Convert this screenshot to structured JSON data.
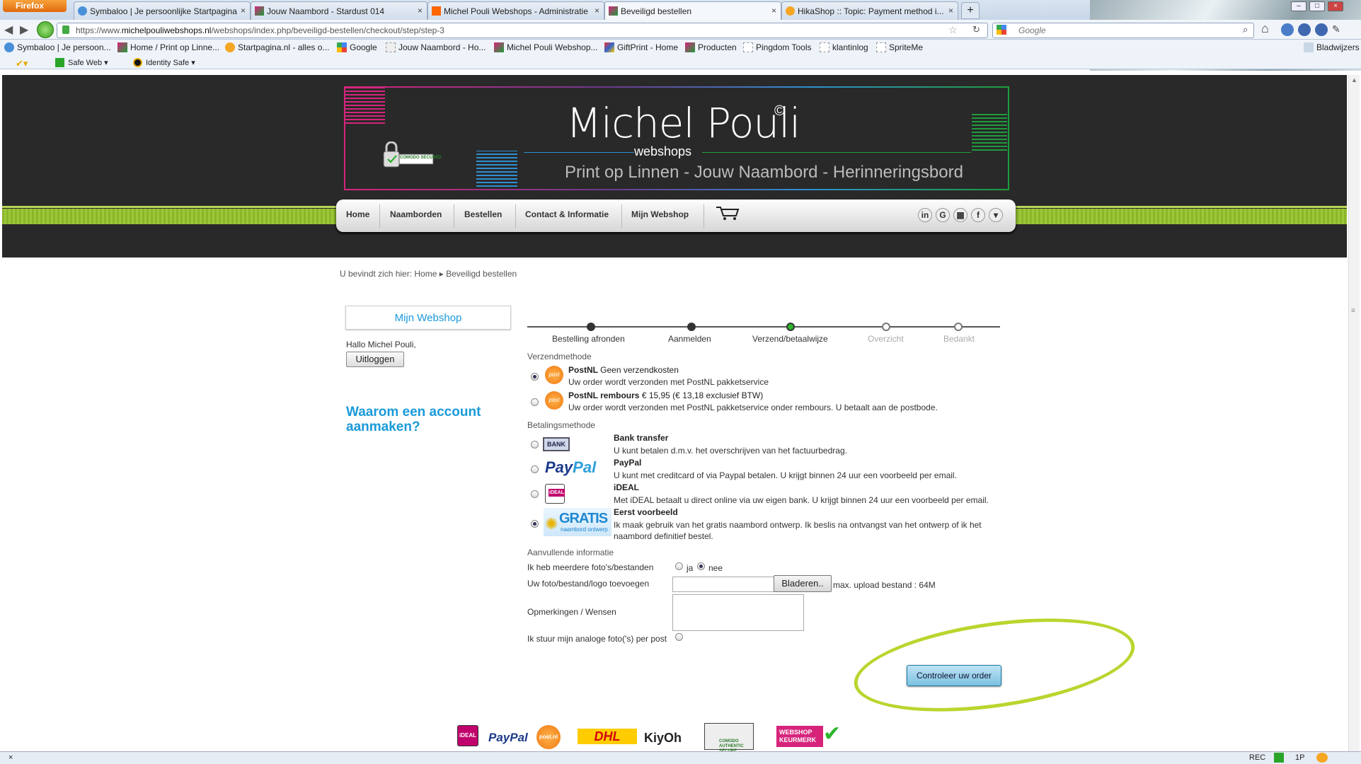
{
  "browser": {
    "menu_label": "Firefox",
    "tabs": [
      {
        "label": "Symbaloo | Je persoonlijke Startpagina"
      },
      {
        "label": "Jouw Naambord - Stardust 014"
      },
      {
        "label": "Michel Pouli Webshops - Administratie"
      },
      {
        "label": "Beveiligd bestellen"
      },
      {
        "label": "HikaShop :: Topic: Payment method i..."
      }
    ],
    "url_prefix": "https://www.",
    "url_host": "michelpouliwebshops.nl",
    "url_path": "/webshops/index.php/beveiligd-bestellen/checkout/step/step-3",
    "search_placeholder": "Google",
    "bookmarks_label": "Bladwijzers",
    "bookmarks": [
      {
        "label": "Symbaloo | Je persoon..."
      },
      {
        "label": "Home / Print op Linne..."
      },
      {
        "label": "Startpagina.nl - alles o..."
      },
      {
        "label": "Google"
      },
      {
        "label": "Jouw Naambord - Ho..."
      },
      {
        "label": "Michel Pouli Webshop..."
      },
      {
        "label": "GiftPrint - Home"
      },
      {
        "label": "Producten"
      },
      {
        "label": "Pingdom Tools"
      },
      {
        "label": "klantinlog"
      },
      {
        "label": "SpriteMe"
      }
    ],
    "toolbar": {
      "safe_web": "Safe Web ▾",
      "identity_safe": "Identity Safe ▾"
    },
    "status": {
      "rec": "REC",
      "onep": "1P"
    }
  },
  "header": {
    "brand": "Michel Pouli",
    "copyright": "©",
    "sub": "webshops",
    "tagline": "Print op Linnen - Jouw Naambord - Herinneringsbord",
    "comodo": "COMODO SECURED"
  },
  "nav": {
    "items": [
      "Home",
      "Naamborden",
      "Bestellen",
      "Contact & Informatie",
      "Mijn Webshop"
    ],
    "social": [
      "in",
      "G",
      "▦",
      "f",
      "▾"
    ]
  },
  "breadcrumb": {
    "prefix": "U bevindt zich hier:",
    "home": "Home",
    "sep": "▸",
    "current": "Beveiligd bestellen"
  },
  "sidebar": {
    "title": "Mijn Webshop",
    "greeting": "Hallo Michel Pouli,",
    "logout": "Uitloggen",
    "why": "Waarom een account aanmaken?"
  },
  "steps": [
    {
      "label": "Bestelling afronden",
      "state": "done"
    },
    {
      "label": "Aanmelden",
      "state": "done"
    },
    {
      "label": "Verzend/betaalwijze",
      "state": "current"
    },
    {
      "label": "Overzicht",
      "state": "todo"
    },
    {
      "label": "Bedankt",
      "state": "todo"
    }
  ],
  "shipping": {
    "heading": "Verzendmethode",
    "options": [
      {
        "name": "PostNL",
        "price": "Geen verzendkosten",
        "desc": "Uw order wordt verzonden met PostNL pakketservice",
        "selected": true
      },
      {
        "name": "PostNL rembours",
        "price": "€ 15,95 (€ 13,18 exclusief BTW)",
        "desc": "Uw order wordt verzonden met PostNL pakketservice onder rembours. U betaalt aan de postbode.",
        "selected": false
      }
    ]
  },
  "payment": {
    "heading": "Betalingsmethode",
    "options": [
      {
        "name": "Bank transfer",
        "desc": "U kunt betalen d.m.v. het overschrijven van het factuurbedrag.",
        "selected": false,
        "icon": "BANK"
      },
      {
        "name": "PayPal",
        "desc": "U kunt met creditcard of via Paypal betalen. U krijgt binnen 24 uur een voorbeeld per email.",
        "selected": false
      },
      {
        "name": "iDEAL",
        "desc": "Met iDEAL betaalt u direct online via uw eigen bank. U krijgt binnen 24 uur een voorbeeld per email.",
        "selected": false
      },
      {
        "name": "Eerst voorbeeld",
        "desc": "Ik maak gebruik van het gratis naambord ontwerp. Ik beslis na ontvangst van het ontwerp of ik het",
        "desc2": "naambord definitief bestel.",
        "selected": true,
        "icon_text": "GRATIS",
        "icon_sub": "naambord ontwerp"
      }
    ]
  },
  "extra": {
    "heading": "Aanvullende informatie",
    "multi_files_label": "Ik heb meerdere foto's/bestanden",
    "yes": "ja",
    "no": "nee",
    "upload_label": "Uw foto/bestand/logo toevoegen",
    "browse": "Bladeren..",
    "max_upload": "max. upload bestand : 64M",
    "remarks_label": "Opmerkingen / Wensen",
    "analog_label": "Ik stuur mijn analoge foto('s) per post"
  },
  "submit": "Controleer uw order",
  "footer_logos": [
    "iDEAL",
    "PayPal",
    "post.nl",
    "DHL",
    "KiyOh",
    "COMODO AUTHENTIC SECURE",
    "WEBSHOP KEURMERK"
  ],
  "colors": {
    "accent": "#1a9ad9",
    "green": "#8bb52a",
    "highlight": "#b8d62e"
  }
}
